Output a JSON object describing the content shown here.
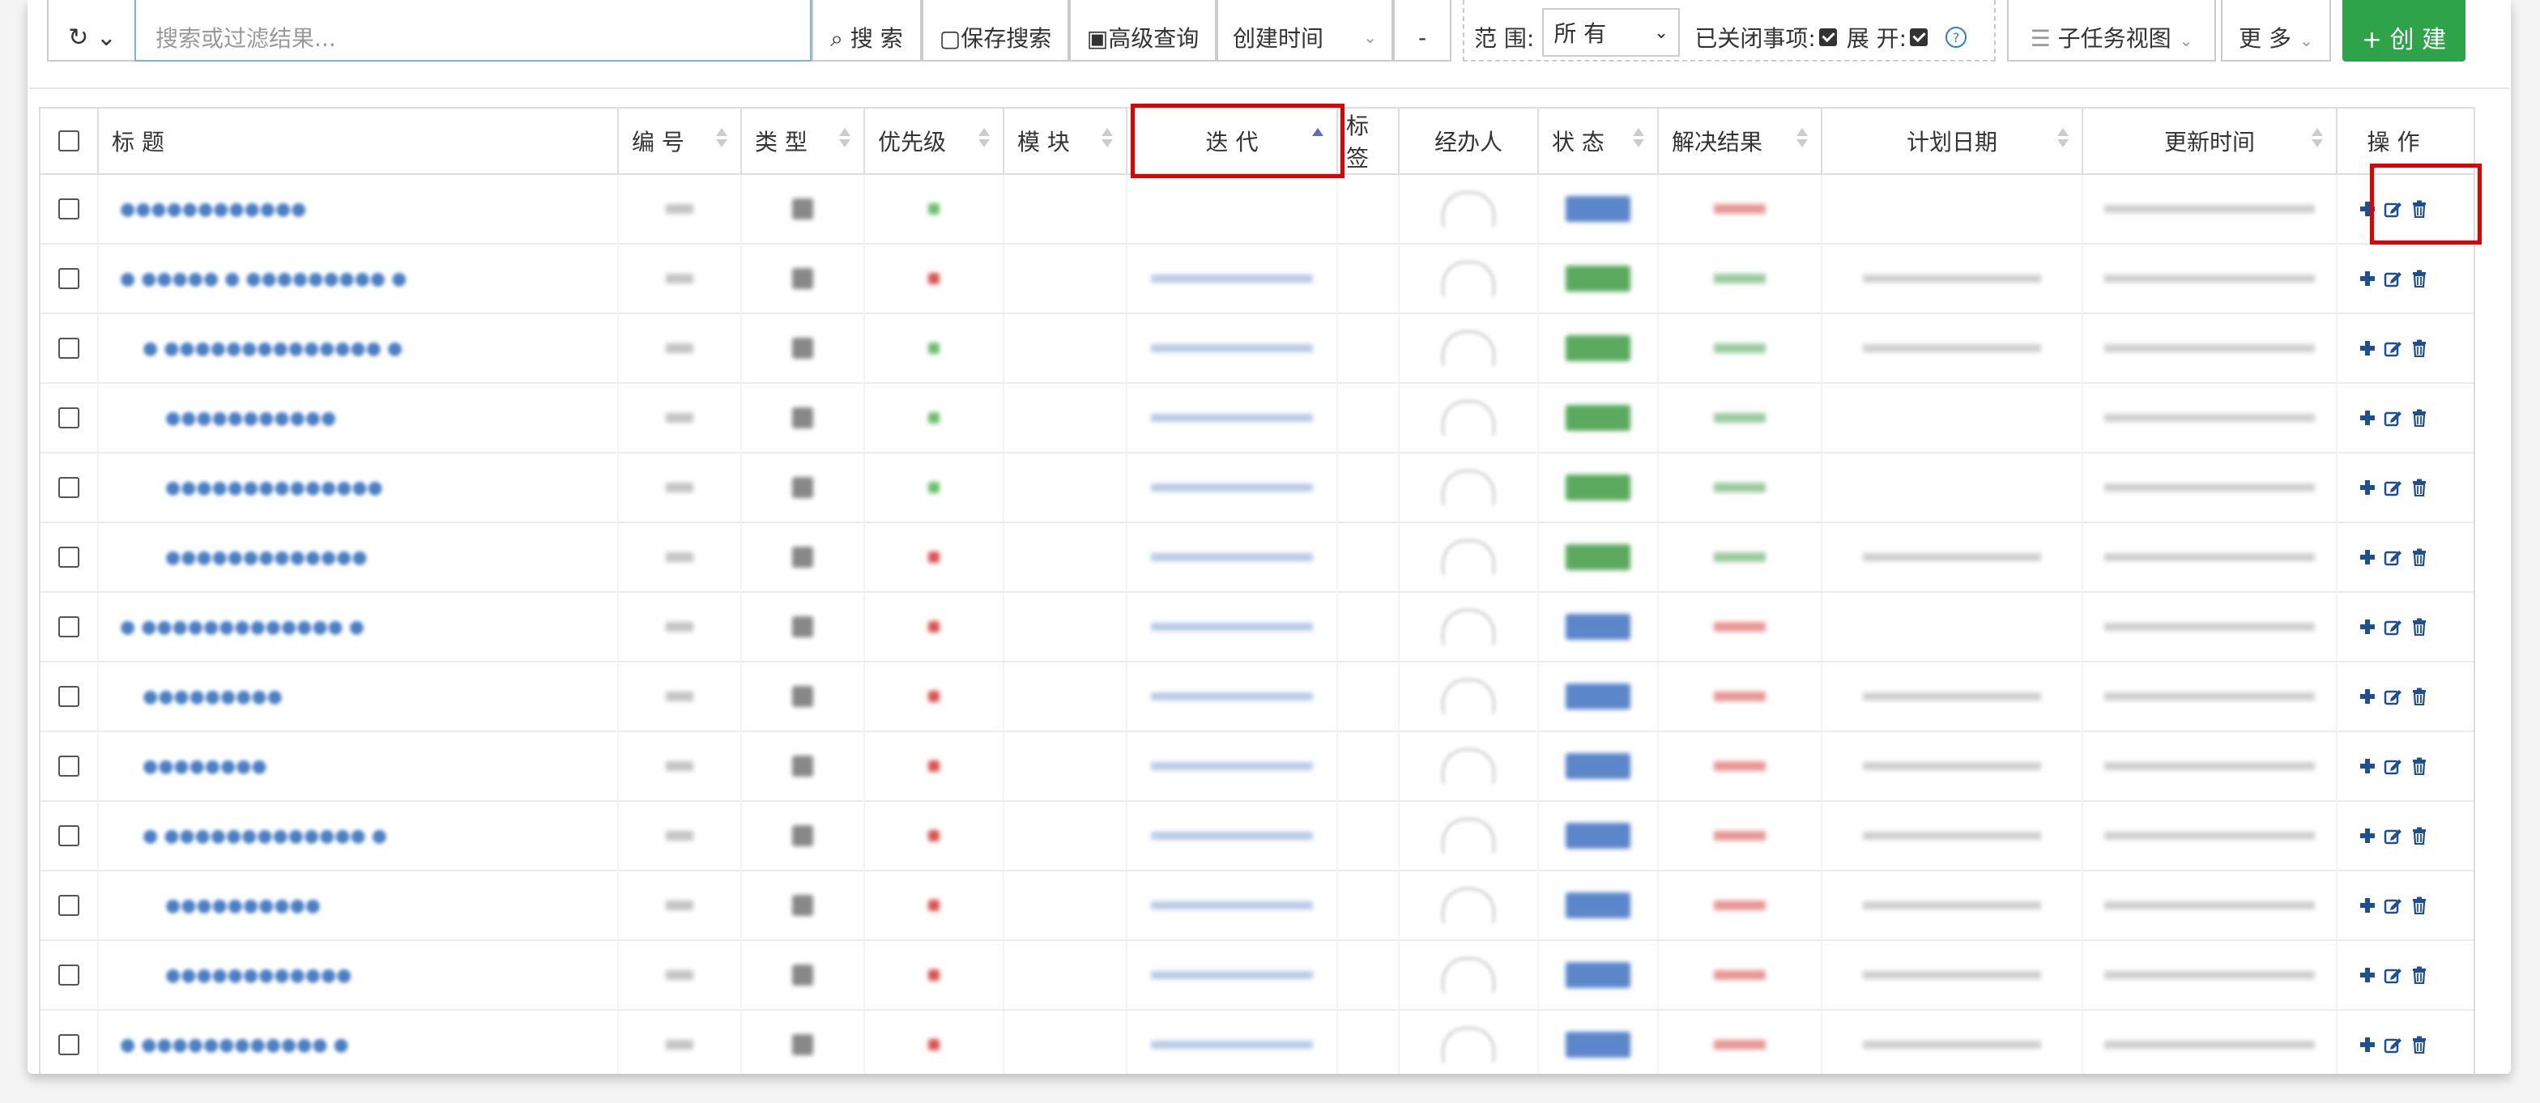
{
  "toolbar": {
    "history_icon": "history-icon",
    "search_placeholder": "搜索或过滤结果...",
    "search_label": "搜 索",
    "save_search_label": "保存搜索",
    "advanced_query_label": "高级查询",
    "sort_field": "创建时间",
    "sort_direction": "-",
    "scope_label": "范 围:",
    "scope_value": "所 有",
    "closed_items_label": "已关闭事项:",
    "expand_label": "展 开:",
    "view_label": "子任务视图",
    "more_label": "更 多",
    "create_label": "+ 创 建"
  },
  "table": {
    "columns": [
      {
        "key": "title",
        "label": "标 题"
      },
      {
        "key": "number",
        "label": "编 号"
      },
      {
        "key": "type",
        "label": "类 型"
      },
      {
        "key": "priority",
        "label": "优先级"
      },
      {
        "key": "module",
        "label": "模 块"
      },
      {
        "key": "iteration",
        "label": "迭 代"
      },
      {
        "key": "tags",
        "label": "标 签"
      },
      {
        "key": "assignee",
        "label": "经办人"
      },
      {
        "key": "status",
        "label": "状 态"
      },
      {
        "key": "resolution",
        "label": "解决结果"
      },
      {
        "key": "plan_date",
        "label": "计划日期"
      },
      {
        "key": "updated",
        "label": "更新时间"
      },
      {
        "key": "actions",
        "label": "操 作"
      }
    ],
    "rows": [
      {
        "indent": 0,
        "title_blurred": "●●●●●●●●●●●●",
        "has_iteration": false,
        "priority": "green",
        "status": "blue",
        "resolution": "red",
        "has_plan": false
      },
      {
        "indent": 0,
        "title_blurred": "● ●●●●● ● ●●●●●●●●● ●",
        "has_iteration": true,
        "priority": "red",
        "status": "green",
        "resolution": "green",
        "has_plan": true
      },
      {
        "indent": 1,
        "title_blurred": "● ●●●●●●●●●●●●●● ●",
        "has_iteration": true,
        "priority": "green",
        "status": "green",
        "resolution": "green",
        "has_plan": true
      },
      {
        "indent": 2,
        "title_blurred": "●●●●●●●●●●●",
        "has_iteration": true,
        "priority": "green",
        "status": "green",
        "resolution": "green",
        "has_plan": false
      },
      {
        "indent": 2,
        "title_blurred": "●●●●●●●●●●●●●●",
        "has_iteration": true,
        "priority": "green",
        "status": "green",
        "resolution": "green",
        "has_plan": false
      },
      {
        "indent": 2,
        "title_blurred": "●●●●●●●●●●●●●",
        "has_iteration": true,
        "priority": "red",
        "status": "green",
        "resolution": "green",
        "has_plan": true
      },
      {
        "indent": 0,
        "title_blurred": "● ●●●●●●●●●●●●● ●",
        "has_iteration": true,
        "priority": "red",
        "status": "blue",
        "resolution": "red",
        "has_plan": false
      },
      {
        "indent": 1,
        "title_blurred": "●●●●●●●●●",
        "has_iteration": true,
        "priority": "red",
        "status": "blue",
        "resolution": "red",
        "has_plan": true
      },
      {
        "indent": 1,
        "title_blurred": "●●●●●●●●",
        "has_iteration": true,
        "priority": "red",
        "status": "blue",
        "resolution": "red",
        "has_plan": true
      },
      {
        "indent": 1,
        "title_blurred": "● ●●●●●●●●●●●●● ●",
        "has_iteration": true,
        "priority": "red",
        "status": "blue",
        "resolution": "red",
        "has_plan": true
      },
      {
        "indent": 2,
        "title_blurred": "●●●●●●●●●●",
        "has_iteration": true,
        "priority": "red",
        "status": "blue",
        "resolution": "red",
        "has_plan": true
      },
      {
        "indent": 2,
        "title_blurred": "●●●●●●●●●●●●",
        "has_iteration": true,
        "priority": "red",
        "status": "blue",
        "resolution": "red",
        "has_plan": true
      },
      {
        "indent": 0,
        "title_blurred": "● ●●●●●●●●●●●● ●",
        "has_iteration": true,
        "priority": "red",
        "status": "blue",
        "resolution": "red",
        "has_plan": true
      }
    ],
    "sorted_column": "iteration",
    "sort_order": "asc"
  },
  "colors": {
    "accent_blue": "#2f6db8",
    "create_green": "#2ea34a",
    "status_green": "#5aa95f",
    "status_blue": "#5b86c9",
    "priority_red": "#d9534f",
    "priority_green": "#6cbf6c",
    "highlight_red": "#e00000"
  },
  "icons": {
    "add": "plus-icon",
    "edit": "edit-icon",
    "delete": "trash-icon"
  }
}
